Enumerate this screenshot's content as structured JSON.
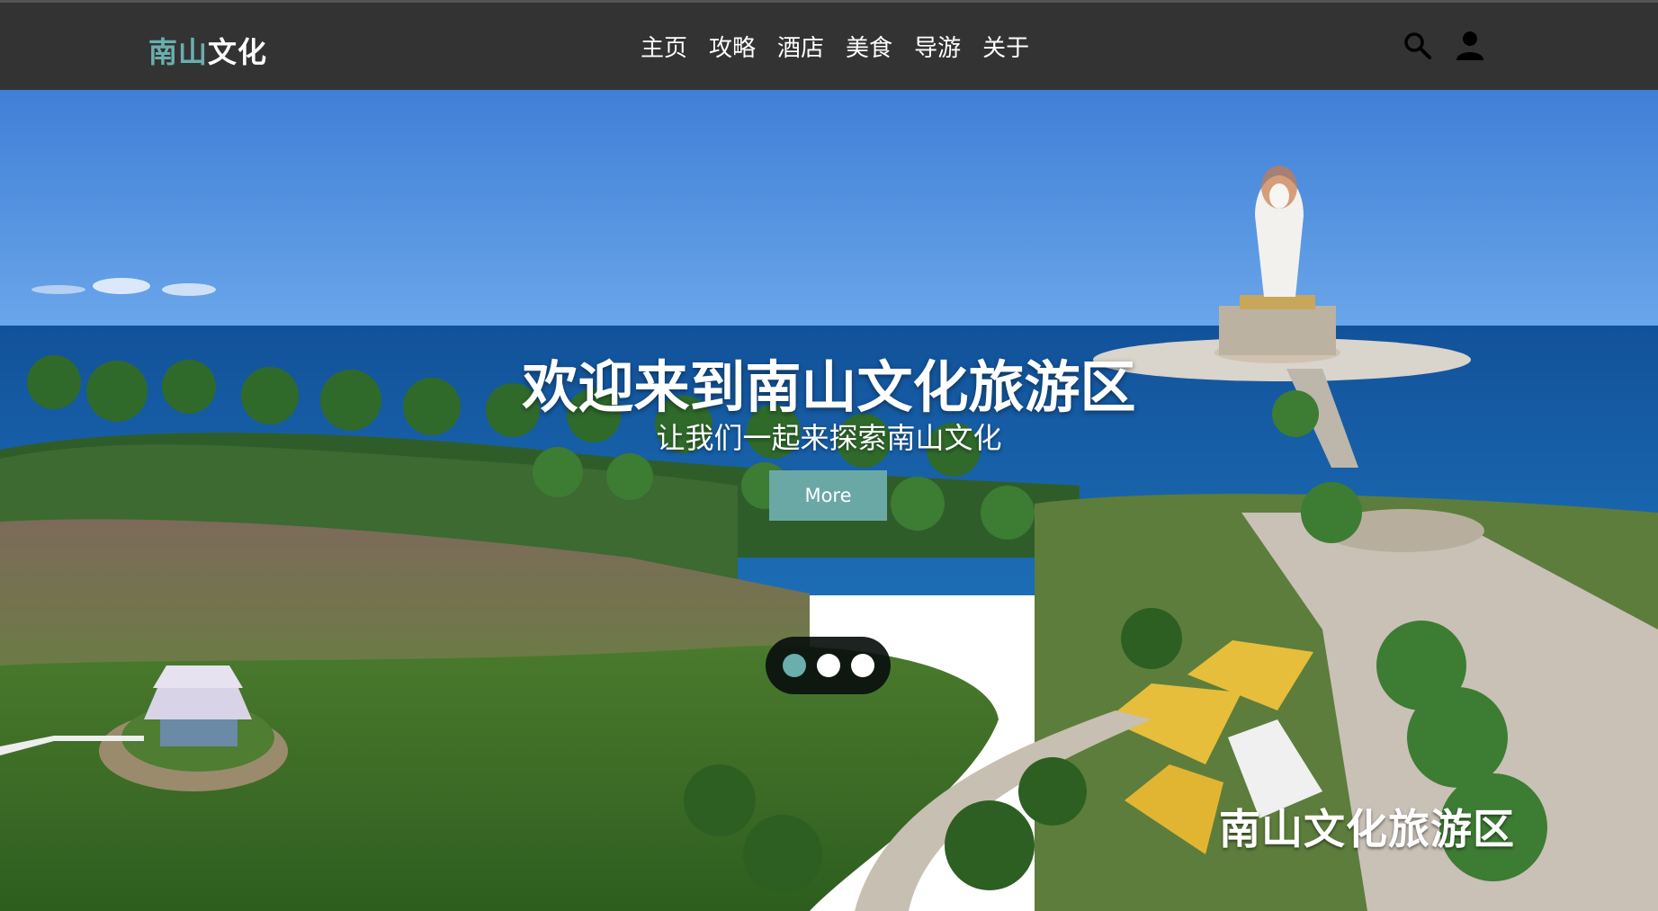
{
  "header": {
    "logo_part1": "南山",
    "logo_part2": "文化",
    "nav": [
      {
        "label": "主页"
      },
      {
        "label": "攻略"
      },
      {
        "label": "酒店"
      },
      {
        "label": "美食"
      },
      {
        "label": "导游"
      },
      {
        "label": "关于"
      }
    ],
    "icons": {
      "search": "search-icon",
      "user": "user-icon"
    }
  },
  "hero": {
    "title": "欢迎来到南山文化旅游区",
    "subtitle": "让我们一起来探索南山文化",
    "button_label": "More",
    "watermark": "南山文化旅游区",
    "carousel": {
      "total": 3,
      "active_index": 0
    }
  },
  "colors": {
    "navbar": "#333333",
    "accent": "#6aaeae",
    "button": "#6aa8a6"
  }
}
